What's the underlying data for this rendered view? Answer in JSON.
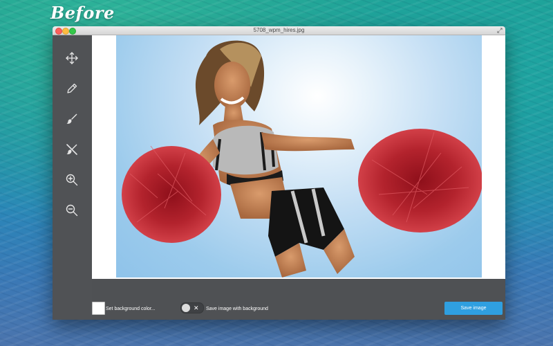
{
  "overlay": {
    "label": "Before"
  },
  "window": {
    "title": "5708_wpm_hires.jpg"
  },
  "tools": [
    {
      "name": "move",
      "icon": "move-arrows-icon"
    },
    {
      "name": "keep-pencil",
      "icon": "pencil-icon"
    },
    {
      "name": "brush",
      "icon": "brush-icon"
    },
    {
      "name": "erase",
      "icon": "crossed-brush-icon"
    },
    {
      "name": "zoom-in",
      "icon": "zoom-in-icon"
    },
    {
      "name": "zoom-out",
      "icon": "zoom-out-icon"
    }
  ],
  "canvas": {
    "image": "cheerleader with red pom-poms on sky-blue backdrop"
  },
  "bottom": {
    "background_color_label": "Set background color...",
    "background_color_value": "#ffffff",
    "toggle_label": "Save image with background",
    "toggle_state_glyph": "✕",
    "save_label": "Save image"
  },
  "colors": {
    "accent": "#2f9fe0",
    "panel": "#4f5154"
  }
}
